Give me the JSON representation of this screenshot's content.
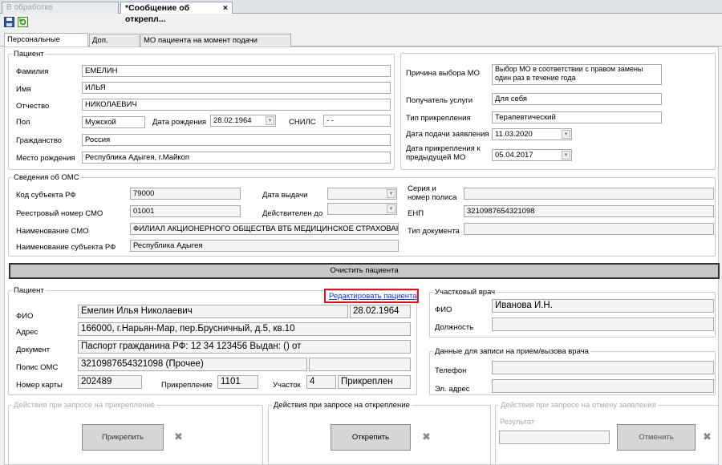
{
  "doc_tabs": [
    {
      "label": "В обработке"
    },
    {
      "label": "*Сообщение об открепл..."
    }
  ],
  "doc_tab_close": "×",
  "toolbar": {
    "save_icon": "save-icon",
    "refresh_icon": "refresh-icon"
  },
  "page_tabs": [
    "Персональные данные",
    "Доп. данные",
    "МО пациента на момент подачи заявления"
  ],
  "patient": {
    "legend": "Пациент",
    "surname_label": "Фамилия",
    "surname": "ЕМЕЛИН",
    "name_label": "Имя",
    "name": "ИЛЬЯ",
    "patronymic_label": "Отчество",
    "patronymic": "НИКОЛАЕВИЧ",
    "sex_label": "Пол",
    "sex": "Мужской",
    "dob_label": "Дата рождения",
    "dob": "28.02.1964",
    "snils_label": "СНИЛС",
    "snils": "-  -",
    "citizenship_label": "Гражданство",
    "citizenship": "Россия",
    "birthplace_label": "Место рождения",
    "birthplace": "Республика Адыгея, г.Майкоп"
  },
  "mo": {
    "reason_label": "Причина выбора МО",
    "reason_line1": "Выбор МО в соответствии с правом замены",
    "reason_line2": "один раз в течение года",
    "recipient_label": "Получатель услуги",
    "recipient": "Для себя",
    "attach_type_label": "Тип прикрепления",
    "attach_type": "Терапевтический",
    "app_date_label": "Дата подачи заявления",
    "app_date": "11.03.2020",
    "prev_date_label1": "Дата прикрепления к",
    "prev_date_label2": "предыдущей МО",
    "prev_date": "05.04.2017"
  },
  "oms": {
    "legend": "Сведения об ОМС",
    "subject_code_label": "Код субъекта РФ",
    "subject_code": "79000",
    "issue_date_label": "Дата выдачи",
    "smo_reg_label": "Реестровый номер СМО",
    "smo_reg": "01001",
    "valid_until_label": "Действителен до",
    "smo_name_label": "Наименование СМО",
    "smo_name": "ФИЛИАЛ АКЦИОНЕРНОГО ОБЩЕСТВА ВТБ МЕДИЦИНСКОЕ СТРАХОВАНИЕ",
    "subject_name_label": "Наименование субъекта РФ",
    "subject_name": "Республика Адыгея",
    "series_label1": "Серия и",
    "series_label2": "номер полиса",
    "series": "",
    "enp_label": "ЕНП",
    "enp": "3210987654321098",
    "doc_type_label": "Тип документа",
    "doc_type": ""
  },
  "clear_button": "Очистить пациента",
  "patient2": {
    "legend": "Пациент",
    "edit_link": "Редактировать пациента",
    "fio_label": "ФИО",
    "fio": "Емелин Илья Николаевич",
    "dob": "28.02.1964",
    "address_label": "Адрес",
    "address": "166000, г.Нарьян-Мар, пер.Брусничный, д.5, кв.10",
    "document_label": "Документ",
    "document": "Паспорт гражданина РФ: 12 34 123456 Выдан: () от",
    "policy_label": "Полис ОМС",
    "policy": "3210987654321098 (Прочее)",
    "policy_extra": "",
    "card_label": "Номер карты",
    "card": "202489",
    "attachment_label": "Прикрепление",
    "attachment": "1101",
    "district_label": "Участок",
    "district": "4",
    "status": "Прикреплен"
  },
  "doctor": {
    "legend": "Участковый врач",
    "fio_label": "ФИО",
    "fio": "Иванова И.Н.",
    "position_label": "Должность",
    "position": ""
  },
  "contact": {
    "legend": "Данные для записи на прием/вызова врача",
    "phone_label": "Телефон",
    "phone": "",
    "email_label": "Эл. адрес",
    "email": ""
  },
  "attach_actions": {
    "legend": "Действия при запросе на прикрепление",
    "button": "Прикрепить"
  },
  "detach_actions": {
    "legend": "Действия при запросе на открепление",
    "button": "Открепить"
  },
  "cancel_actions": {
    "legend": "Действия при запросе на отмену заявления",
    "result_label": "Результат",
    "result": "",
    "button": "Отменить"
  },
  "pin_icon": "pin-icon",
  "colors": {
    "link": "#1a34d8",
    "highlight": "#e0141e",
    "panel": "#ffffff",
    "background": "#f0f0f0"
  }
}
